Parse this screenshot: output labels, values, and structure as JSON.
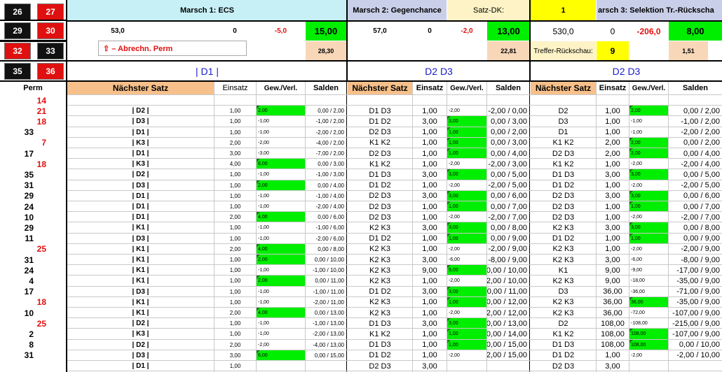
{
  "colors": {
    "green": "#00ee00",
    "orange": "#f7c08a",
    "light_blue": "#c9cfe8",
    "cyan": "#c7f0f6",
    "yellow": "#ffff00",
    "cream": "#fdf3c6",
    "red": "#e01010",
    "peach": "#f8d7b8"
  },
  "tiles": [
    {
      "value": "26",
      "color": "black"
    },
    {
      "value": "27",
      "color": "red"
    },
    {
      "value": "29",
      "color": "black"
    },
    {
      "value": "30",
      "color": "red"
    },
    {
      "value": "32",
      "color": "red"
    },
    {
      "value": "33",
      "color": "black"
    },
    {
      "value": "35",
      "color": "black"
    },
    {
      "value": "36",
      "color": "red"
    }
  ],
  "header": {
    "marsch1": "Marsch 1: ECS",
    "marsch2": "Marsch 2: Gegenchance",
    "satz_dk_label": "Satz-DK:",
    "satz_dk_value": "1",
    "marsch3": "arsch 3: Selektion Tr.-Rückscha",
    "m1_a": "53,0",
    "m1_b": "0",
    "m1_c": "-5,0",
    "m1_d": "15,00",
    "m2_a": "57,0",
    "m2_b": "0",
    "m2_c": "-2,0",
    "m2_d": "13,00",
    "m3_a": "530,0",
    "m3_b": "0",
    "m3_c": "-206,0",
    "m3_d": "8,00",
    "abrechn_label": "⇧ – Abrechn. Perm",
    "m1_e": "28,30",
    "m2_e": "22,81",
    "treffer_label": "Treffer-Rückschau:",
    "treffer_value": "9",
    "m3_e": "1,51",
    "sel1": "| D1 |",
    "sel2": "D2  D3",
    "sel3": "D2  D3"
  },
  "columns": {
    "perm": "Perm",
    "naechster": "Nächster Satz",
    "einsatz": "Einsatz",
    "gewverl": "Gew./Verl.",
    "salden": "Salden"
  },
  "rows": [
    {
      "perm": "14",
      "pc": "red",
      "s1": "",
      "e1": "",
      "g1": "",
      "g1g": false,
      "sa1": "",
      "s2": "",
      "e2": "",
      "g2": "",
      "g2g": false,
      "sa2": "",
      "s3": "",
      "e3": "",
      "g3": "",
      "g3g": false,
      "sa3": ""
    },
    {
      "perm": "21",
      "pc": "red",
      "s1": "| D2 |",
      "e1": "1,00",
      "g1": "2,00",
      "g1g": true,
      "sa1": "0,00 / 2,00",
      "s2": "D1 D3",
      "e2": "1,00",
      "g2": "-2,00",
      "g2g": false,
      "sa2": "-2,00 / 0,00",
      "s3": "D2",
      "e3": "1,00",
      "g3": "2,00",
      "g3g": true,
      "sa3": "0,00 / 2,00"
    },
    {
      "perm": "18",
      "pc": "red",
      "s1": "| D3 |",
      "e1": "1,00",
      "g1": "-1,00",
      "g1g": false,
      "sa1": "-1,00 / 2,00",
      "s2": "D1 D2",
      "e2": "3,00",
      "g2": "3,00",
      "g2g": true,
      "sa2": "0,00 / 3,00",
      "s3": "D3",
      "e3": "1,00",
      "g3": "-1,00",
      "g3g": false,
      "sa3": "-1,00 / 2,00"
    },
    {
      "perm": "33",
      "pc": "black",
      "s1": "| D1 |",
      "e1": "1,00",
      "g1": "-1,00",
      "g1g": false,
      "sa1": "-2,00 / 2,00",
      "s2": "D2 D3",
      "e2": "1,00",
      "g2": "1,00",
      "g2g": true,
      "sa2": "0,00 / 2,00",
      "s3": "D1",
      "e3": "1,00",
      "g3": "-1,00",
      "g3g": false,
      "sa3": "-2,00 / 2,00"
    },
    {
      "perm": "7",
      "pc": "red",
      "s1": "| K3 |",
      "e1": "2,00",
      "g1": "-2,00",
      "g1g": false,
      "sa1": "-4,00 / 2,00",
      "s2": "K1 K2",
      "e2": "1,00",
      "g2": "1,00",
      "g2g": true,
      "sa2": "0,00 / 3,00",
      "s3": "K1 K2",
      "e3": "2,00",
      "g3": "2,00",
      "g3g": true,
      "sa3": "0,00 / 2,00"
    },
    {
      "perm": "17",
      "pc": "black",
      "s1": "| D1 |",
      "e1": "3,00",
      "g1": "-3,00",
      "g1g": false,
      "sa1": "-7,00 / 2,00",
      "s2": "D2 D3",
      "e2": "1,00",
      "g2": "1,00",
      "g2g": true,
      "sa2": "0,00 / 4,00",
      "s3": "D2 D3",
      "e3": "2,00",
      "g3": "2,00",
      "g3g": true,
      "sa3": "0,00 / 4,00"
    },
    {
      "perm": "18",
      "pc": "red",
      "s1": "| K3 |",
      "e1": "4,00",
      "g1": "8,00",
      "g1g": true,
      "sa1": "0,00 / 3,00",
      "s2": "K1 K2",
      "e2": "1,00",
      "g2": "-2,00",
      "g2g": false,
      "sa2": "-2,00 / 3,00",
      "s3": "K1 K2",
      "e3": "1,00",
      "g3": "-2,00",
      "g3g": false,
      "sa3": "-2,00 / 4,00"
    },
    {
      "perm": "35",
      "pc": "black",
      "s1": "| D2 |",
      "e1": "1,00",
      "g1": "-1,00",
      "g1g": false,
      "sa1": "-1,00 / 3,00",
      "s2": "D1 D3",
      "e2": "3,00",
      "g2": "3,00",
      "g2g": true,
      "sa2": "0,00 / 5,00",
      "s3": "D1 D3",
      "e3": "3,00",
      "g3": "3,00",
      "g3g": true,
      "sa3": "0,00 / 5,00"
    },
    {
      "perm": "31",
      "pc": "black",
      "s1": "| D3 |",
      "e1": "1,00",
      "g1": "2,00",
      "g1g": true,
      "sa1": "0,00 / 4,00",
      "s2": "D1 D2",
      "e2": "1,00",
      "g2": "-2,00",
      "g2g": false,
      "sa2": "-2,00 / 5,00",
      "s3": "D1 D2",
      "e3": "1,00",
      "g3": "-2,00",
      "g3g": false,
      "sa3": "-2,00 / 5,00"
    },
    {
      "perm": "29",
      "pc": "black",
      "s1": "| D1 |",
      "e1": "1,00",
      "g1": "-1,00",
      "g1g": false,
      "sa1": "-1,00 / 4,00",
      "s2": "D2 D3",
      "e2": "3,00",
      "g2": "3,00",
      "g2g": true,
      "sa2": "0,00 / 6,00",
      "s3": "D2 D3",
      "e3": "3,00",
      "g3": "3,00",
      "g3g": true,
      "sa3": "0,00 / 6,00"
    },
    {
      "perm": "24",
      "pc": "black",
      "s1": "| D1 |",
      "e1": "1,00",
      "g1": "-1,00",
      "g1g": false,
      "sa1": "-2,00 / 4,00",
      "s2": "D2 D3",
      "e2": "1,00",
      "g2": "1,00",
      "g2g": true,
      "sa2": "0,00 / 7,00",
      "s3": "D2 D3",
      "e3": "1,00",
      "g3": "1,00",
      "g3g": true,
      "sa3": "0,00 / 7,00"
    },
    {
      "perm": "10",
      "pc": "black",
      "s1": "| D1 |",
      "e1": "2,00",
      "g1": "4,00",
      "g1g": true,
      "sa1": "0,00 / 6,00",
      "s2": "D2 D3",
      "e2": "1,00",
      "g2": "-2,00",
      "g2g": false,
      "sa2": "-2,00 / 7,00",
      "s3": "D2 D3",
      "e3": "1,00",
      "g3": "-2,00",
      "g3g": false,
      "sa3": "-2,00 / 7,00"
    },
    {
      "perm": "29",
      "pc": "black",
      "s1": "| K1 |",
      "e1": "1,00",
      "g1": "-1,00",
      "g1g": false,
      "sa1": "-1,00 / 6,00",
      "s2": "K2 K3",
      "e2": "3,00",
      "g2": "3,00",
      "g2g": true,
      "sa2": "0,00 / 8,00",
      "s3": "K2 K3",
      "e3": "3,00",
      "g3": "3,00",
      "g3g": true,
      "sa3": "0,00 / 8,00"
    },
    {
      "perm": "11",
      "pc": "black",
      "s1": "| D3 |",
      "e1": "1,00",
      "g1": "-1,00",
      "g1g": false,
      "sa1": "-2,00 / 6,00",
      "s2": "D1 D2",
      "e2": "1,00",
      "g2": "1,00",
      "g2g": true,
      "sa2": "0,00 / 9,00",
      "s3": "D1 D2",
      "e3": "1,00",
      "g3": "1,00",
      "g3g": true,
      "sa3": "0,00 / 9,00"
    },
    {
      "perm": "25",
      "pc": "red",
      "s1": "| K1 |",
      "e1": "2,00",
      "g1": "4,00",
      "g1g": true,
      "sa1": "0,00 / 8,00",
      "s2": "K2 K3",
      "e2": "1,00",
      "g2": "-2,00",
      "g2g": false,
      "sa2": "-2,00 / 9,00",
      "s3": "K2 K3",
      "e3": "1,00",
      "g3": "-2,00",
      "g3g": false,
      "sa3": "-2,00 / 9,00"
    },
    {
      "perm": "31",
      "pc": "black",
      "s1": "| K1 |",
      "e1": "1,00",
      "g1": "2,00",
      "g1g": true,
      "sa1": "0,00 / 10,00",
      "s2": "K2 K3",
      "e2": "3,00",
      "g2": "-6,00",
      "g2g": false,
      "sa2": "-8,00 / 9,00",
      "s3": "K2 K3",
      "e3": "3,00",
      "g3": "-6,00",
      "g3g": false,
      "sa3": "-8,00 / 9,00"
    },
    {
      "perm": "24",
      "pc": "black",
      "s1": "| K1 |",
      "e1": "1,00",
      "g1": "-1,00",
      "g1g": false,
      "sa1": "-1,00 / 10,00",
      "s2": "K2 K3",
      "e2": "9,00",
      "g2": "9,00",
      "g2g": true,
      "sa2": "0,00 / 10,00",
      "s3": "K1",
      "e3": "9,00",
      "g3": "-9,00",
      "g3g": false,
      "sa3": "-17,00 / 9,00"
    },
    {
      "perm": "4",
      "pc": "black",
      "s1": "| K1 |",
      "e1": "1,00",
      "g1": "2,00",
      "g1g": true,
      "sa1": "0,00 / 11,00",
      "s2": "K2 K3",
      "e2": "1,00",
      "g2": "-2,00",
      "g2g": false,
      "sa2": "-2,00 / 10,00",
      "s3": "K2 K3",
      "e3": "9,00",
      "g3": "-18,00",
      "g3g": false,
      "sa3": "-35,00 / 9,00"
    },
    {
      "perm": "17",
      "pc": "black",
      "s1": "| D3 |",
      "e1": "1,00",
      "g1": "-1,00",
      "g1g": false,
      "sa1": "-1,00 / 11,00",
      "s2": "D1 D2",
      "e2": "3,00",
      "g2": "3,00",
      "g2g": true,
      "sa2": "0,00 / 11,00",
      "s3": "D3",
      "e3": "36,00",
      "g3": "-36,00",
      "g3g": false,
      "sa3": "-71,00 / 9,00"
    },
    {
      "perm": "18",
      "pc": "red",
      "s1": "| K1 |",
      "e1": "1,00",
      "g1": "-1,00",
      "g1g": false,
      "sa1": "-2,00 / 11,00",
      "s2": "K2 K3",
      "e2": "1,00",
      "g2": "1,00",
      "g2g": true,
      "sa2": "0,00 / 12,00",
      "s3": "K2 K3",
      "e3": "36,00",
      "g3": "36,00",
      "g3g": true,
      "sa3": "-35,00 / 9,00"
    },
    {
      "perm": "10",
      "pc": "black",
      "s1": "| K1 |",
      "e1": "2,00",
      "g1": "4,00",
      "g1g": true,
      "sa1": "0,00 / 13,00",
      "s2": "K2 K3",
      "e2": "1,00",
      "g2": "-2,00",
      "g2g": false,
      "sa2": "-2,00 / 12,00",
      "s3": "K2 K3",
      "e3": "36,00",
      "g3": "-72,00",
      "g3g": false,
      "sa3": "-107,00 / 9,00"
    },
    {
      "perm": "25",
      "pc": "red",
      "s1": "| D2 |",
      "e1": "1,00",
      "g1": "-1,00",
      "g1g": false,
      "sa1": "-1,00 / 13,00",
      "s2": "D1 D3",
      "e2": "3,00",
      "g2": "3,00",
      "g2g": true,
      "sa2": "0,00 / 13,00",
      "s3": "D2",
      "e3": "108,00",
      "g3": "-108,00",
      "g3g": false,
      "sa3": "-215,00 / 9,00"
    },
    {
      "perm": "2",
      "pc": "black",
      "s1": "| K3 |",
      "e1": "1,00",
      "g1": "-1,00",
      "g1g": false,
      "sa1": "-2,00 / 13,00",
      "s2": "K1 K2",
      "e2": "1,00",
      "g2": "1,00",
      "g2g": true,
      "sa2": "0,00 / 14,00",
      "s3": "K1 K2",
      "e3": "108,00",
      "g3": "108,00",
      "g3g": true,
      "sa3": "-107,00 / 9,00"
    },
    {
      "perm": "8",
      "pc": "black",
      "s1": "| D2 |",
      "e1": "2,00",
      "g1": "-2,00",
      "g1g": false,
      "sa1": "-4,00 / 13,00",
      "s2": "D1 D3",
      "e2": "1,00",
      "g2": "1,00",
      "g2g": true,
      "sa2": "0,00 / 15,00",
      "s3": "D1 D3",
      "e3": "108,00",
      "g3": "108,00",
      "g3g": true,
      "sa3": "0,00 / 10,00"
    },
    {
      "perm": "31",
      "pc": "black",
      "s1": "| D3 |",
      "e1": "3,00",
      "g1": "6,00",
      "g1g": true,
      "sa1": "0,00 / 15,00",
      "s2": "D1 D2",
      "e2": "1,00",
      "g2": "-2,00",
      "g2g": false,
      "sa2": "-2,00 / 15,00",
      "s3": "D1 D2",
      "e3": "1,00",
      "g3": "-2,00",
      "g3g": false,
      "sa3": "-2,00 / 10,00"
    },
    {
      "perm": "",
      "pc": "black",
      "s1": "| D1 |",
      "e1": "1,00",
      "g1": "",
      "g1g": false,
      "sa1": "",
      "s2": "D2 D3",
      "e2": "3,00",
      "g2": "",
      "g2g": false,
      "sa2": "",
      "s3": "D2 D3",
      "e3": "3,00",
      "g3": "",
      "g3g": false,
      "sa3": ""
    }
  ]
}
